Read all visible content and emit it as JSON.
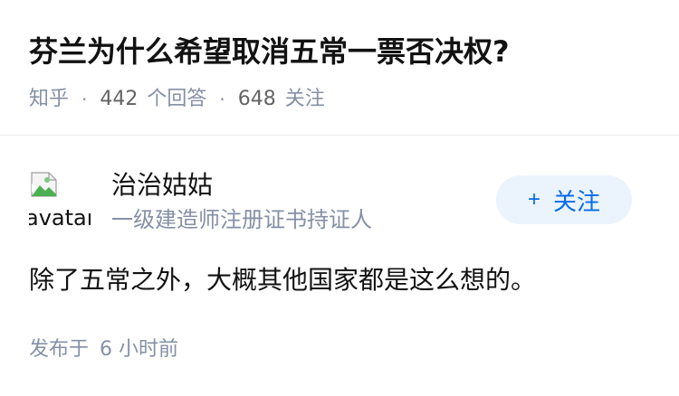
{
  "question": {
    "title": "芬兰为什么希望取消五常一票否决权?",
    "source": "知乎",
    "separator": "·",
    "answers_count": "442",
    "answers_label": "个回答",
    "followers_count": "648",
    "followers_label": "关注"
  },
  "answer": {
    "author": {
      "avatar_alt": "avatar",
      "name": "治治姑姑",
      "bio": "一级建造师注册证书持证人"
    },
    "follow_button": {
      "icon": "plus-icon",
      "plus": "+",
      "label": "关注",
      "color": "#056de8",
      "background": "#ebf3fd"
    },
    "content": "除了五常之外，大概其他国家都是这么想的。",
    "published_label": "发布于",
    "published_time": "6 小时前"
  },
  "colors": {
    "text_primary": "#121212",
    "text_secondary": "#8590a6",
    "divider": "#ebebeb"
  }
}
